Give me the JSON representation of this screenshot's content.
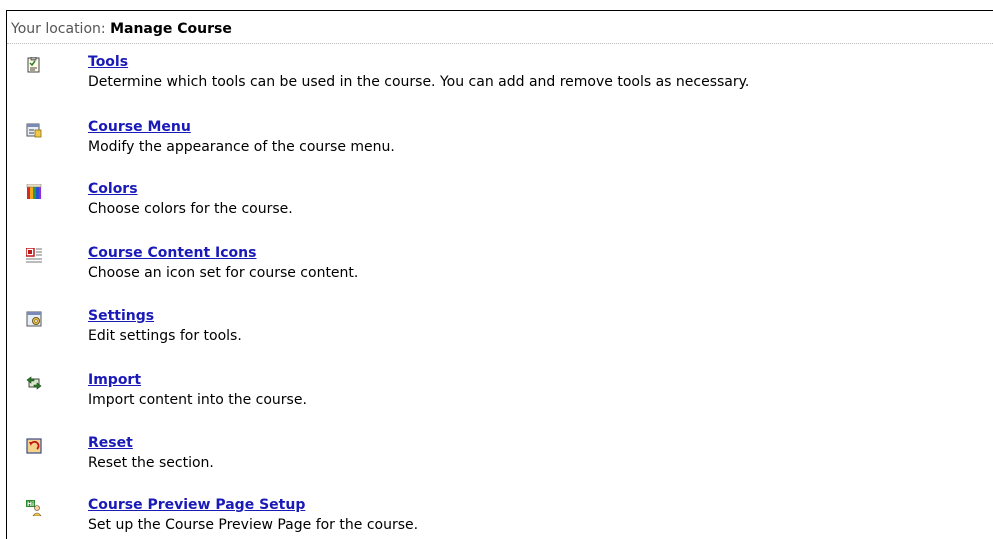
{
  "breadcrumb": {
    "label": "Your location:",
    "current": "Manage Course"
  },
  "items": [
    {
      "title": "Tools",
      "description": "Determine which tools can be used in the course. You can add and remove tools as necessary.",
      "icon": "tools-icon"
    },
    {
      "title": "Course Menu",
      "description": "Modify the appearance of the course menu.",
      "icon": "course-menu-icon"
    },
    {
      "title": "Colors",
      "description": "Choose colors for the course.",
      "icon": "colors-icon"
    },
    {
      "title": "Course Content Icons",
      "description": "Choose an icon set for course content.",
      "icon": "content-icons-icon"
    },
    {
      "title": "Settings",
      "description": "Edit settings for tools.",
      "icon": "settings-icon"
    },
    {
      "title": "Import",
      "description": "Import content into the course.",
      "icon": "import-icon"
    },
    {
      "title": "Reset",
      "description": "Reset the section.",
      "icon": "reset-icon"
    },
    {
      "title": "Course Preview Page Setup",
      "description": "Set up the Course Preview Page for the course.",
      "icon": "preview-setup-icon"
    }
  ],
  "colors": {
    "link": "#1a1ab8",
    "text": "#000000",
    "breadcrumb_label": "#555555"
  }
}
